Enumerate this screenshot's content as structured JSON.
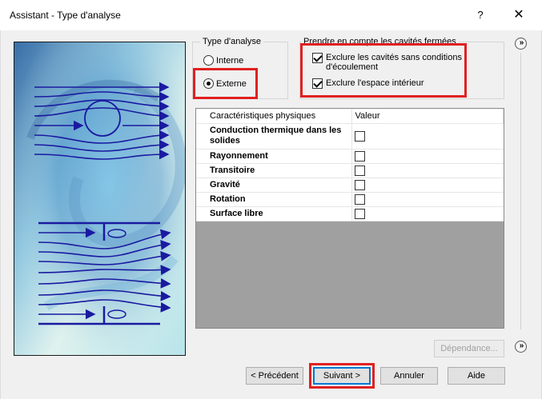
{
  "window": {
    "title": "Assistant - Type d'analyse",
    "help_label": "?",
    "close_label": "✕"
  },
  "analysis_type": {
    "group_label": "Type d'analyse",
    "options": [
      {
        "label": "Interne",
        "selected": false
      },
      {
        "label": "Externe",
        "selected": true
      }
    ]
  },
  "closed_cavities": {
    "group_label": "Prendre en compte les cavités fermées",
    "options": [
      {
        "label": "Exclure les cavités sans conditions d'écoulement",
        "checked": true
      },
      {
        "label": "Exclure l'espace intérieur",
        "checked": true
      }
    ]
  },
  "physical_features": {
    "headers": [
      "Caractéristiques physiques",
      "Valeur"
    ],
    "rows": [
      {
        "label": "Conduction thermique dans les solides",
        "checked": false
      },
      {
        "label": "Rayonnement",
        "checked": false
      },
      {
        "label": "Transitoire",
        "checked": false
      },
      {
        "label": "Gravité",
        "checked": false
      },
      {
        "label": "Rotation",
        "checked": false
      },
      {
        "label": "Surface libre",
        "checked": false
      }
    ]
  },
  "buttons": {
    "dependency": "Dépendance...",
    "previous": "< Précédent",
    "next": "Suivant >",
    "cancel": "Annuler",
    "help": "Aide"
  },
  "icons": {
    "expand_top": "chevron-double-right-icon",
    "expand_bottom": "chevron-double-right-icon"
  },
  "colors": {
    "highlight": "#e02020",
    "flow_lines": "#1a1aa0",
    "default_button_border": "#0078d7"
  }
}
